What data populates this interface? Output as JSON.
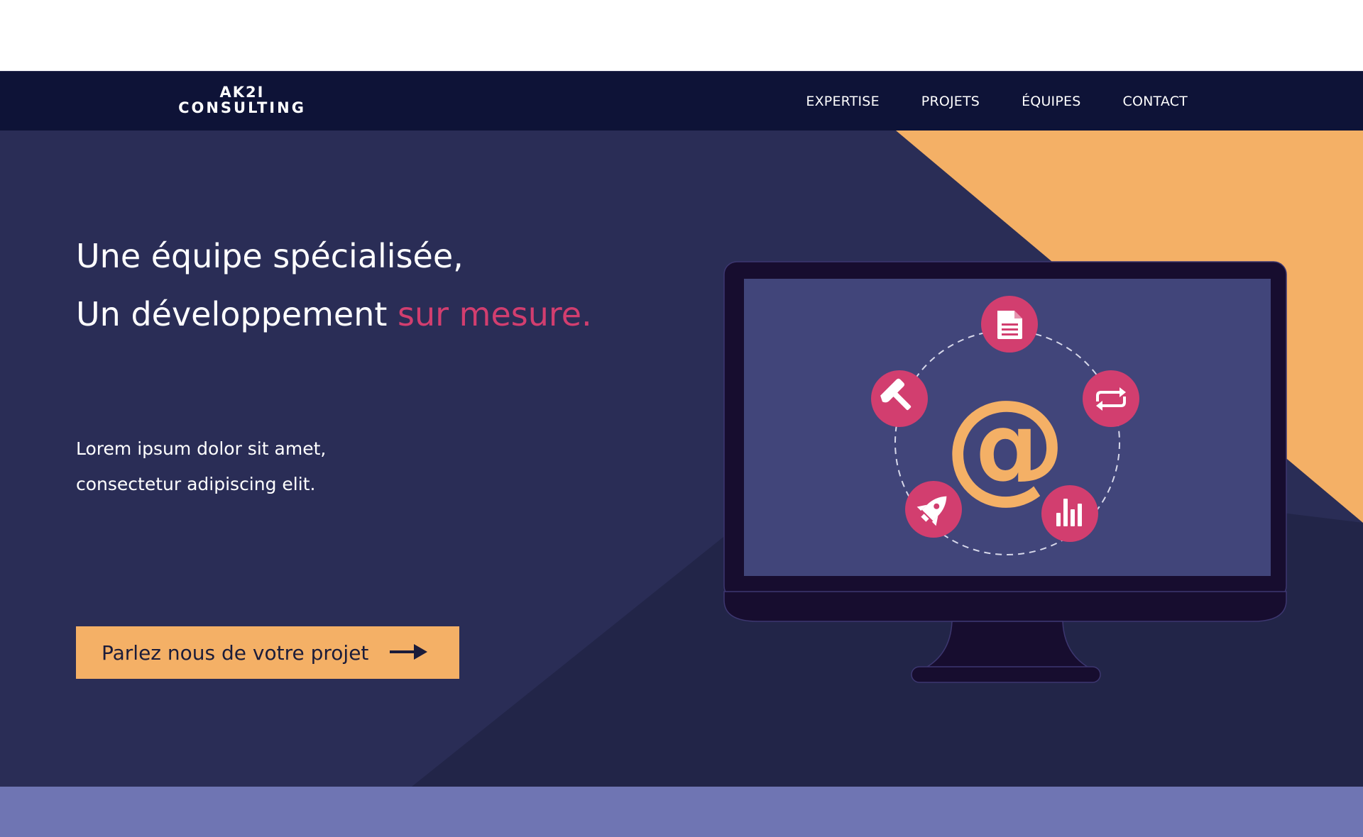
{
  "brand": {
    "logo_line1": "AK2I",
    "logo_line2": "CONSULTING"
  },
  "nav": {
    "items": [
      "EXPERTISE",
      "PROJETS",
      "ÉQUIPES",
      "CONTACT"
    ]
  },
  "hero": {
    "headline_line1": "Une équipe spécialisée,",
    "headline_line2_main": "Un développement ",
    "headline_line2_accent": "sur mesure.",
    "lead_line1": "Lorem ipsum dolor sit amet,",
    "lead_line2": "consectetur adipiscing elit.",
    "cta_label": "Parlez nous de votre projet"
  },
  "illustration": {
    "center_symbol": "@",
    "icons": [
      "document-icon",
      "repeat-icon",
      "bar-chart-icon",
      "rocket-icon",
      "hammer-icon"
    ]
  },
  "colors": {
    "navbar": "#0e1337",
    "hero_bg": "#2a2d56",
    "hero_shadow": "#222548",
    "accent_orange": "#f4b066",
    "accent_pink": "#d23e6f",
    "screen": "#41457a",
    "monitor_frame": "#170d2f",
    "footer_band": "#6f75b3"
  }
}
